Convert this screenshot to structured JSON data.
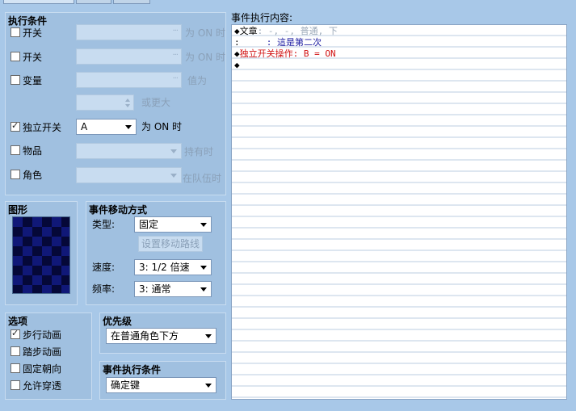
{
  "conditions": {
    "title": "执行条件",
    "switch1": {
      "label": "开关",
      "checked": false,
      "suffix": "为 ON 时"
    },
    "switch2": {
      "label": "开关",
      "checked": false,
      "suffix": "为 ON 时"
    },
    "variable": {
      "label": "变量",
      "checked": false,
      "suffix": "值为",
      "or_more": "或更大"
    },
    "self_switch": {
      "label": "独立开关",
      "checked": true,
      "value": "A",
      "suffix": "为 ON 时"
    },
    "item": {
      "label": "物品",
      "checked": false,
      "suffix": "持有时"
    },
    "actor": {
      "label": "角色",
      "checked": false,
      "suffix": "在队伍时"
    },
    "dots": "···"
  },
  "graphic": {
    "title": "图形"
  },
  "movement": {
    "title": "事件移动方式",
    "type_label": "类型:",
    "type_value": "固定",
    "route_button": "设置移动路线",
    "speed_label": "速度:",
    "speed_value": "3: 1/2 倍速",
    "freq_label": "频率:",
    "freq_value": "3: 通常"
  },
  "options": {
    "title": "选项",
    "items": [
      {
        "label": "步行动画",
        "checked": true
      },
      {
        "label": "踏步动画",
        "checked": false
      },
      {
        "label": "固定朝向",
        "checked": false
      },
      {
        "label": "允许穿透",
        "checked": false
      }
    ]
  },
  "priority": {
    "title": "优先级",
    "value": "在普通角色下方"
  },
  "trigger": {
    "title": "事件执行条件",
    "value": "确定键"
  },
  "contents": {
    "label": "事件执行内容:",
    "lines": [
      {
        "marker": "◆",
        "text": "文章",
        "cont": ": -, -, 普通, 下"
      },
      {
        "marker": ":",
        "text": "     : 這是第二次"
      },
      {
        "marker": "◆",
        "text": "独立开关操作: B = ON"
      },
      {
        "marker": "◆",
        "text": ""
      }
    ]
  },
  "colors": {
    "panel": "#a0c0e0",
    "background": "#a8c8e8",
    "command_red": "#d01010",
    "text_blue": "#1a1aa0"
  }
}
